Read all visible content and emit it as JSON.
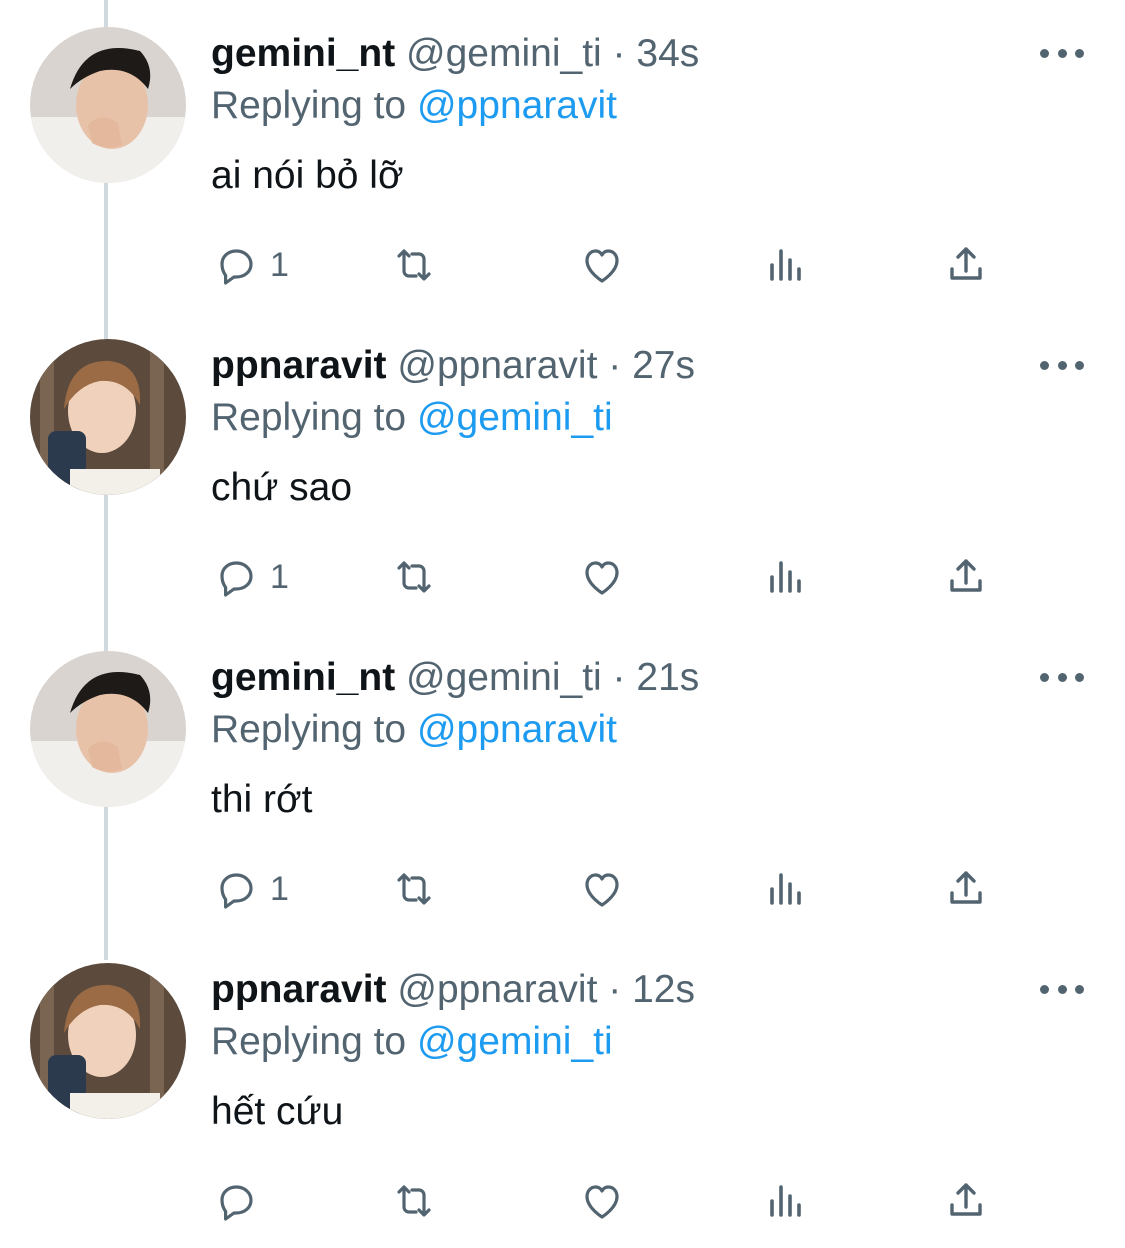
{
  "tweets": [
    {
      "display_name": "gemini_nt",
      "handle": "@gemini_ti",
      "separator": "·",
      "time": "34s",
      "replying_prefix": "Replying to",
      "replying_to": "@ppnaravit",
      "text": "ai nói bỏ lỡ",
      "reply_count": "1",
      "avatar": "gemini-photo"
    },
    {
      "display_name": "ppnaravit",
      "handle": "@ppnaravit",
      "separator": "·",
      "time": "27s",
      "replying_prefix": "Replying to",
      "replying_to": "@gemini_ti",
      "text": "chứ sao",
      "reply_count": "1",
      "avatar": "ppnaravit-photo"
    },
    {
      "display_name": "gemini_nt",
      "handle": "@gemini_ti",
      "separator": "·",
      "time": "21s",
      "replying_prefix": "Replying to",
      "replying_to": "@ppnaravit",
      "text": "thi rớt",
      "reply_count": "1",
      "avatar": "gemini-photo"
    },
    {
      "display_name": "ppnaravit",
      "handle": "@ppnaravit",
      "separator": "·",
      "time": "12s",
      "replying_prefix": "Replying to",
      "replying_to": "@gemini_ti",
      "text": "hết cứu",
      "reply_count": "",
      "avatar": "ppnaravit-photo"
    }
  ],
  "icons": [
    "reply-icon",
    "retweet-icon",
    "like-icon",
    "views-icon",
    "share-icon",
    "more-icon"
  ],
  "colors": {
    "text": "#0f1419",
    "secondary": "#536471",
    "link": "#1d9bf0",
    "thread_line": "#cfd9de"
  }
}
